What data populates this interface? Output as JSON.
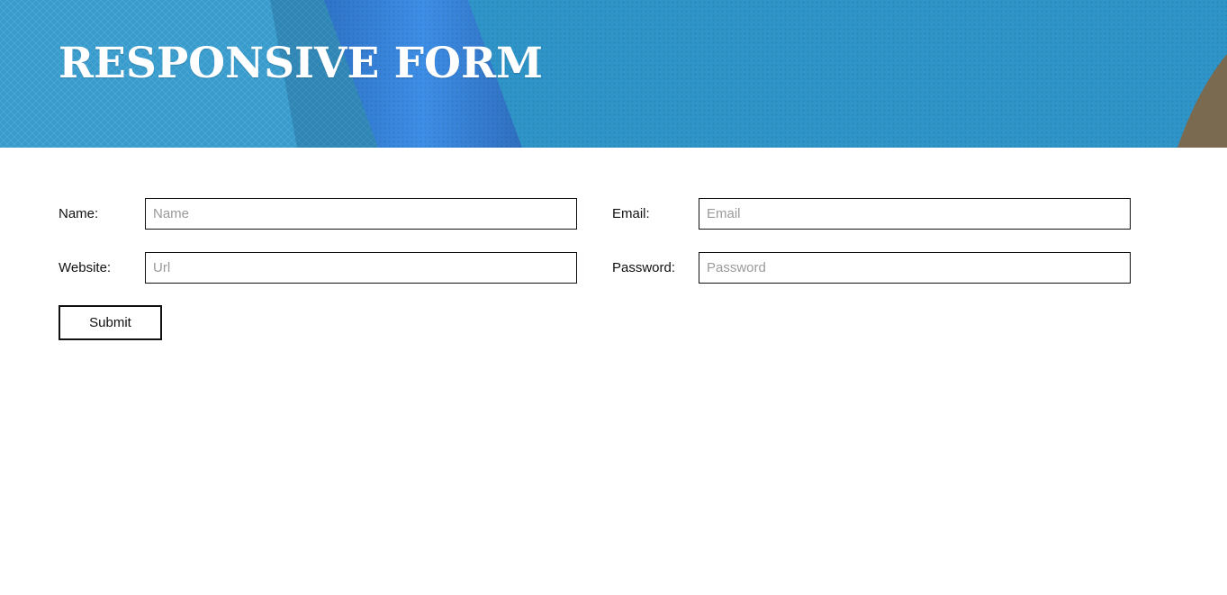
{
  "header": {
    "title": "RESPONSIVE FORM"
  },
  "form": {
    "name": {
      "label": "Name:",
      "placeholder": "Name",
      "value": ""
    },
    "email": {
      "label": "Email:",
      "placeholder": "Email",
      "value": ""
    },
    "website": {
      "label": "Website:",
      "placeholder": "Url",
      "value": ""
    },
    "password": {
      "label": "Password:",
      "placeholder": "Password",
      "value": ""
    },
    "submit_label": "Submit"
  },
  "colors": {
    "banner_base": "#3399cc",
    "banner_band": "#3b8fe0",
    "banner_corner": "#7a6a50",
    "title": "#ffffff",
    "border": "#111111",
    "placeholder": "#9a9a9a"
  }
}
